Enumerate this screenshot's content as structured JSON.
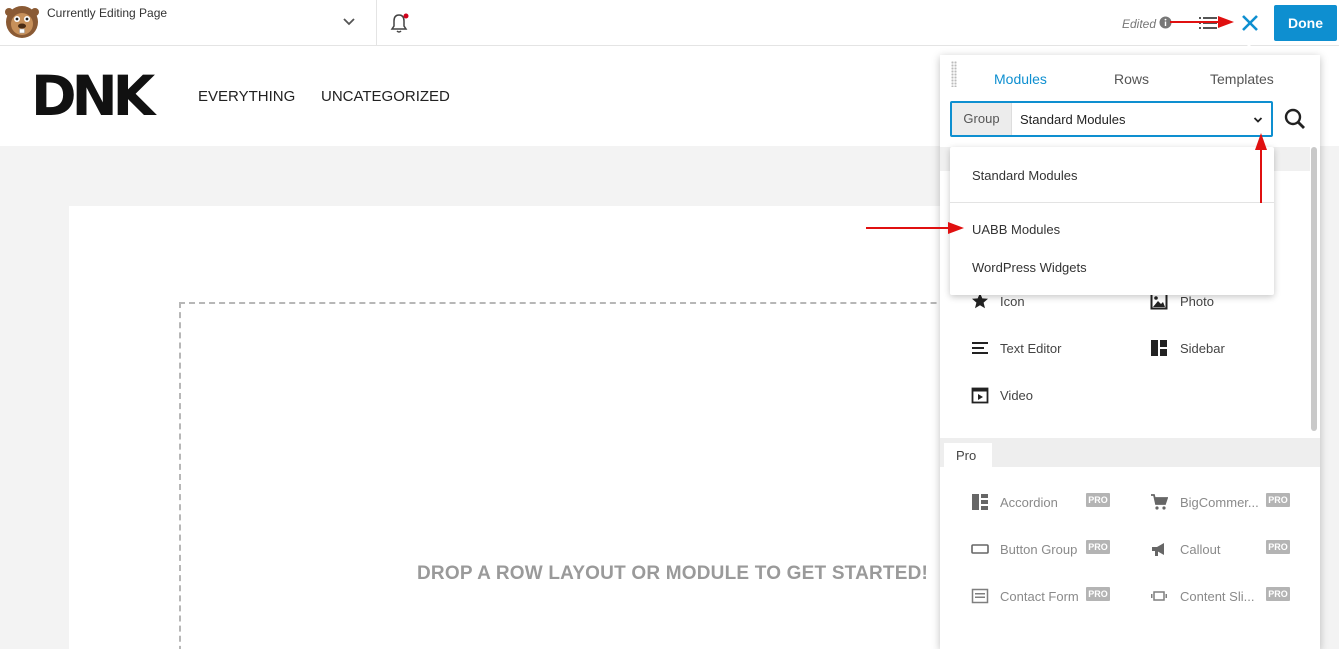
{
  "topbar": {
    "editing_title": "Currently Editing Page",
    "status": "Edited",
    "done_label": "Done"
  },
  "site": {
    "logo": "DNK",
    "nav": [
      "EVERYTHING",
      "UNCATEGORIZED"
    ]
  },
  "canvas": {
    "drop_text": "DROP A ROW LAYOUT OR MODULE TO GET STARTED!"
  },
  "panel": {
    "tabs": [
      "Modules",
      "Rows",
      "Templates"
    ],
    "active_tab": "Modules",
    "group_label": "Group",
    "group_value": "Standard Modules",
    "modules": [
      {
        "label": "Icon",
        "icon": "star-icon"
      },
      {
        "label": "Photo",
        "icon": "photo-icon"
      },
      {
        "label": "Text Editor",
        "icon": "text-editor-icon"
      },
      {
        "label": "Sidebar",
        "icon": "sidebar-icon"
      },
      {
        "label": "Video",
        "icon": "video-icon"
      }
    ],
    "pro_section": "Pro",
    "pro_badge": "PRO",
    "pro_modules": [
      {
        "label": "Accordion",
        "icon": "accordion-icon"
      },
      {
        "label": "BigCommer...",
        "icon": "cart-icon"
      },
      {
        "label": "Button Group",
        "icon": "button-group-icon"
      },
      {
        "label": "Callout",
        "icon": "megaphone-icon"
      },
      {
        "label": "Contact Form",
        "icon": "contact-form-icon"
      },
      {
        "label": "Content Sli...",
        "icon": "content-slider-icon"
      }
    ]
  },
  "dropdown": {
    "options": [
      "Standard Modules",
      "UABB Modules",
      "WordPress Widgets"
    ]
  },
  "colors": {
    "accent": "#0e8fd0",
    "annotation_arrow": "#e01010"
  }
}
